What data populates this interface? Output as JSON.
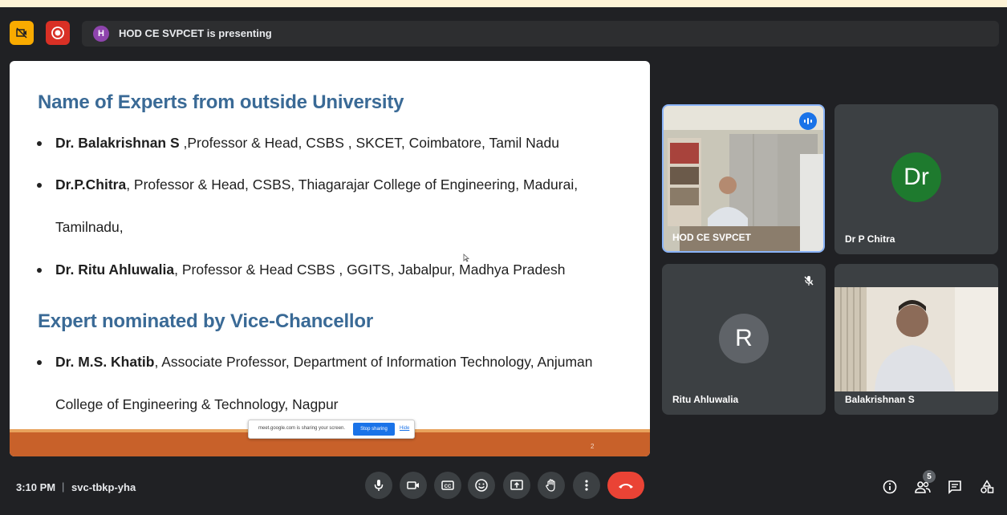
{
  "topbar": {
    "presenter_initial": "H",
    "presenting_text": "HOD CE SVPCET is presenting"
  },
  "slide": {
    "heading1": "Name of Experts from outside University",
    "experts": [
      {
        "name": "Dr. Balakrishnan S",
        "detail": " ,Professor & Head, CSBS , SKCET, Coimbatore, Tamil Nadu"
      },
      {
        "name": "Dr.P.Chitra",
        "detail": ", Professor & Head, CSBS, Thiagarajar College of Engineering, Madurai,"
      },
      {
        "continuation": "Tamilnadu,"
      },
      {
        "name": "Dr. Ritu Ahluwalia",
        "detail": ", Professor & Head CSBS , GGITS, Jabalpur, Madhya Pradesh"
      }
    ],
    "heading2": "Expert nominated by Vice-Chancellor",
    "nominee": {
      "name": "Dr. M.S. Khatib",
      "detail": ", Associate Professor, Department of Information Technology, Anjuman"
    },
    "nominee_continuation": "College of Engineering & Technology, Nagpur",
    "page_number": "2",
    "share_banner": {
      "text": "meet.google.com is sharing your screen.",
      "stop_label": "Stop sharing",
      "hide_label": "Hide"
    }
  },
  "participants": [
    {
      "name": "HOD CE SVPCET",
      "type": "video",
      "speaking": true
    },
    {
      "name": "Dr P Chitra",
      "type": "avatar",
      "initials": "Dr",
      "color": "#1e7a2e"
    },
    {
      "name": "Ritu Ahluwalia",
      "type": "avatar",
      "initials": "R",
      "color": "#5f6368",
      "muted": true
    },
    {
      "name": "Balakrishnan S",
      "type": "video"
    }
  ],
  "bottombar": {
    "time": "3:10 PM",
    "separator": "|",
    "meeting_code": "svc-tbkp-yha",
    "participant_count": "5"
  }
}
